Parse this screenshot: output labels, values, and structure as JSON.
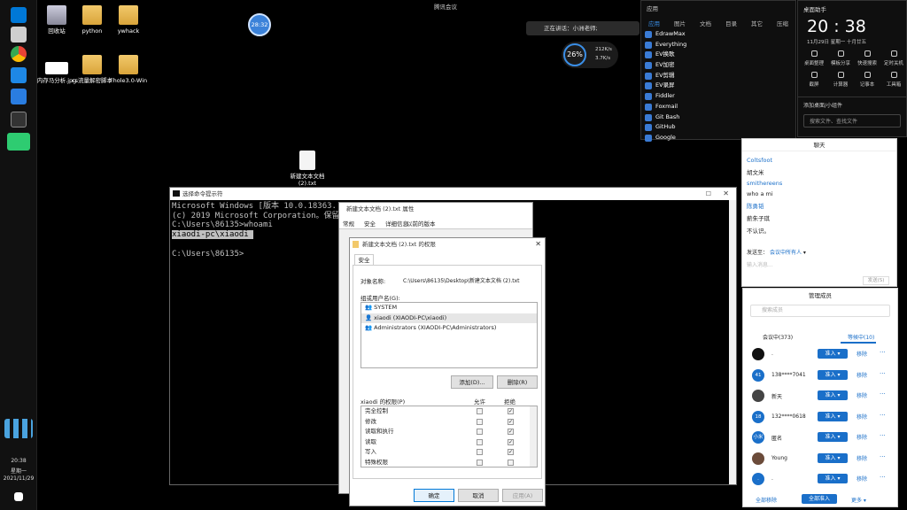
{
  "taskbar": {
    "clock_time": "20:38",
    "clock_day": "星期一",
    "clock_date": "2021/11/29"
  },
  "desktop": {
    "icons": [
      {
        "label": "回收站",
        "kind": "recycle"
      },
      {
        "label": "python",
        "kind": "folder"
      },
      {
        "label": "ywhack",
        "kind": "folder"
      },
      {
        "label": "内存马分析.jpg",
        "kind": "image"
      },
      {
        "label": "cs流量解密脚本",
        "kind": "folder"
      },
      {
        "label": "Fhole3.0-Win",
        "kind": "folder"
      },
      {
        "label": "新建文本文档 (2).txt",
        "kind": "file"
      }
    ],
    "badge": "28:32",
    "meeting_label": "腾讯会议",
    "speaking": "正在讲话：小洲老师;",
    "net_percent": "26%",
    "net_up": "212K/s",
    "net_down": "3.7K/s"
  },
  "cmd": {
    "title": "选择命令提示符",
    "lines": [
      "Microsoft Windows [版本 10.0.18363.",
      "(c) 2019 Microsoft Corporation。保留",
      "",
      "C:\\Users\\86135>whoami"
    ],
    "selected": "xiaodi-pc\\xiaodi ",
    "prompt": "C:\\Users\\86135>"
  },
  "props": {
    "title": "新建文本文档 (2).txt 属性",
    "tabs": [
      "常规",
      "安全",
      "详细信息",
      "以前的版本"
    ]
  },
  "perm": {
    "title": "新建文本文档 (2).txt 的权限",
    "tab": "安全",
    "object_label": "对象名称:",
    "object_value": "C:\\Users\\86135\\Desktop\\新建文本文档 (2).txt",
    "group_label": "组或用户名(G):",
    "groups": [
      "SYSTEM",
      "xiaodi (XIAODI-PC\\xiaodi)",
      "Administrators (XIAODI-PC\\Administrators)"
    ],
    "add": "添加(D)...",
    "remove": "删除(R)",
    "perm_label": "xiaodi 的权限(P)",
    "allow": "允许",
    "deny": "拒绝",
    "perms": [
      {
        "name": "完全控制",
        "deny": true
      },
      {
        "name": "修改",
        "deny": true
      },
      {
        "name": "读取和执行",
        "deny": true
      },
      {
        "name": "读取",
        "deny": true
      },
      {
        "name": "写入",
        "deny": true
      },
      {
        "name": "特殊权限",
        "deny": false
      }
    ],
    "ok": "确定",
    "cancel": "取消",
    "apply": "应用(A)"
  },
  "apps": {
    "tabs": [
      "应用",
      "图片",
      "文档",
      "目录",
      "其它",
      "压缩"
    ],
    "header": "应用",
    "items": [
      "EdrawMax",
      "Everything",
      "EV换歌",
      "EV加密",
      "EV剪辑",
      "EV录屏",
      "Fiddler",
      "Foxmail",
      "Git Bash",
      "GitHub",
      "Google"
    ]
  },
  "assistant": {
    "title": "桌面助手",
    "time": "20 : 38",
    "date": "11月29日  星期一  十月廿五",
    "row1": [
      "桌面整理",
      "模板分享",
      "快速搜索",
      "定时关机"
    ],
    "row2": [
      "截屏",
      "计算器",
      "记事本",
      "工具箱"
    ],
    "add": "添加桌面/小组件",
    "search": "搜索文件、查找文件"
  },
  "chat": {
    "title": "聊天",
    "msgs": [
      {
        "name": "Coltsfoot",
        "text": "胡文米"
      },
      {
        "name": "smithereens",
        "text": "who a mi"
      },
      {
        "name": "陈勇韬",
        "text": "薪朱子琪"
      },
      {
        "name": "",
        "text": "不认识。"
      }
    ],
    "send_to_label": "发送至：",
    "send_to": "会议中所有人",
    "placeholder": "输入消息...",
    "send": "发送(S)"
  },
  "members": {
    "title": "管理成员",
    "search": "搜索成员",
    "tab_in": "会议中(373)",
    "tab_wait": "等候中(10)",
    "list": [
      {
        "name": ".",
        "avatar": "",
        "color": "#111"
      },
      {
        "name": "138****7041",
        "avatar": "41",
        "color": "#1a6fc9"
      },
      {
        "name": "新天",
        "avatar": "",
        "color": "#444"
      },
      {
        "name": "132****0618",
        "avatar": "18",
        "color": "#1a6fc9"
      },
      {
        "name": "匿名",
        "avatar": "小米",
        "color": "#1a6fc9"
      },
      {
        "name": "Young",
        "avatar": "",
        "color": "#6b4b3a"
      },
      {
        "name": ".",
        "avatar": ".",
        "color": "#1a6fc9"
      }
    ],
    "admit": "准入",
    "remove": "移除",
    "more": "···",
    "all_remove": "全部移除",
    "all_admit": "全部准入",
    "more2": "更多"
  }
}
